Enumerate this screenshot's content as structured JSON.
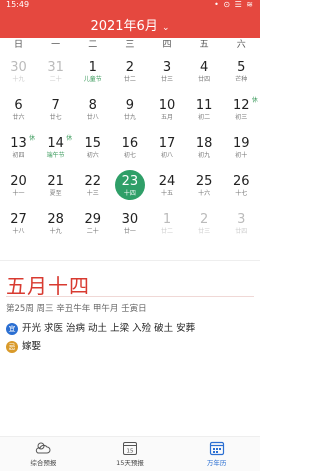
{
  "status": {
    "time": "15:49",
    "icons": "• ⊙ ☰ ≋"
  },
  "header": {
    "title": "2021年6月",
    "dropdown_icon": "chevron-down-icon"
  },
  "weekdays": [
    "日",
    "一",
    "二",
    "三",
    "四",
    "五",
    "六"
  ],
  "calendar": {
    "days": [
      {
        "s": "30",
        "l": "十九",
        "dim": true
      },
      {
        "s": "31",
        "l": "二十",
        "dim": true
      },
      {
        "s": "1",
        "l": "儿童节",
        "f": true
      },
      {
        "s": "2",
        "l": "廿二"
      },
      {
        "s": "3",
        "l": "廿三"
      },
      {
        "s": "4",
        "l": "廿四"
      },
      {
        "s": "5",
        "l": "芒种"
      },
      {
        "s": "6",
        "l": "廿六"
      },
      {
        "s": "7",
        "l": "廿七"
      },
      {
        "s": "8",
        "l": "廿八"
      },
      {
        "s": "9",
        "l": "廿九"
      },
      {
        "s": "10",
        "l": "五月"
      },
      {
        "s": "11",
        "l": "初二"
      },
      {
        "s": "12",
        "l": "初三",
        "rest": "休"
      },
      {
        "s": "13",
        "l": "初四",
        "rest": "休"
      },
      {
        "s": "14",
        "l": "端午节",
        "f": true,
        "rest": "休"
      },
      {
        "s": "15",
        "l": "初六"
      },
      {
        "s": "16",
        "l": "初七"
      },
      {
        "s": "17",
        "l": "初八"
      },
      {
        "s": "18",
        "l": "初九"
      },
      {
        "s": "19",
        "l": "初十"
      },
      {
        "s": "20",
        "l": "十一"
      },
      {
        "s": "21",
        "l": "夏至"
      },
      {
        "s": "22",
        "l": "十三"
      },
      {
        "s": "23",
        "l": "十四",
        "sel": true
      },
      {
        "s": "24",
        "l": "十五"
      },
      {
        "s": "25",
        "l": "十六"
      },
      {
        "s": "26",
        "l": "十七"
      },
      {
        "s": "27",
        "l": "十八"
      },
      {
        "s": "28",
        "l": "十九"
      },
      {
        "s": "29",
        "l": "二十"
      },
      {
        "s": "30",
        "l": "廿一"
      },
      {
        "s": "1",
        "l": "廿二",
        "dim": true
      },
      {
        "s": "2",
        "l": "廿三",
        "dim": true
      },
      {
        "s": "3",
        "l": "廿四",
        "dim": true
      }
    ]
  },
  "detail": {
    "lunar_date": "五月十四",
    "info": "第25周  周三  辛丑牛年  甲午月  壬寅日",
    "yi_label": "宜",
    "yi_text": "开光 求医 治病 动土 上梁 入殓 破土 安葬",
    "ji_label": "忌",
    "ji_text": "嫁娶"
  },
  "nav": [
    {
      "label": "综合预报",
      "icon": "weather-icon"
    },
    {
      "label": "15天预报",
      "icon": "calendar-15-icon"
    },
    {
      "label": "万年历",
      "icon": "calendar-icon",
      "active": true
    }
  ],
  "colors": {
    "header": "#e5483f",
    "selected": "#2f9f68",
    "lunar_text": "#d83a30",
    "yi": "#2b6fd2",
    "ji": "#d99a2a"
  }
}
